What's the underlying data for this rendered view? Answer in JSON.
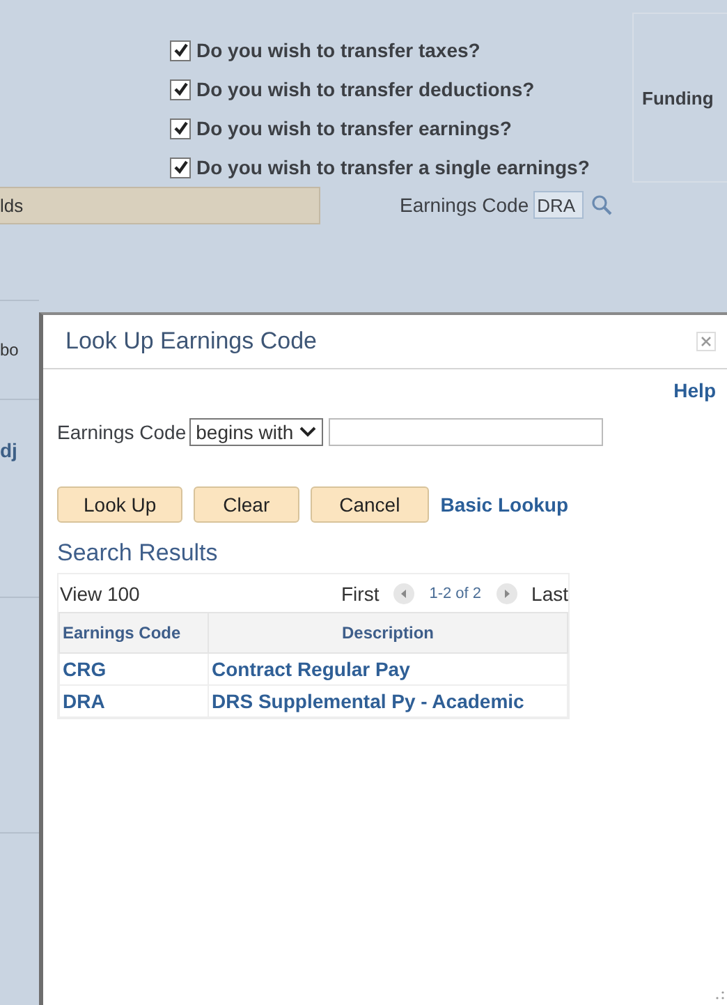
{
  "questions": [
    {
      "label": "Do you wish to transfer taxes?",
      "checked": true
    },
    {
      "label": "Do you wish to transfer deductions?",
      "checked": true
    },
    {
      "label": "Do you wish to transfer earnings?",
      "checked": true
    },
    {
      "label": "Do you wish to transfer a single earnings?",
      "checked": true
    }
  ],
  "funding_panel": {
    "label": "Funding"
  },
  "section_bar": {
    "label": "lds"
  },
  "earnings_code": {
    "label": "Earnings Code",
    "value": "DRA"
  },
  "background_fragments": [
    "bo",
    "dj"
  ],
  "dialog": {
    "title": "Look Up Earnings Code",
    "help": "Help",
    "search": {
      "label": "Earnings Code",
      "operator": "begins with"
    },
    "buttons": [
      "Look Up",
      "Clear",
      "Cancel"
    ],
    "link": "Basic Lookup",
    "results_title": "Search Results",
    "grid": {
      "view": "View 100",
      "first": "First",
      "range": "1-2 of 2",
      "last": "Last",
      "columns": [
        "Earnings Code",
        "Description"
      ],
      "rows": [
        [
          "CRG",
          "Contract Regular Pay"
        ],
        [
          "DRA",
          "DRS Supplemental Py - Academic"
        ]
      ]
    }
  }
}
